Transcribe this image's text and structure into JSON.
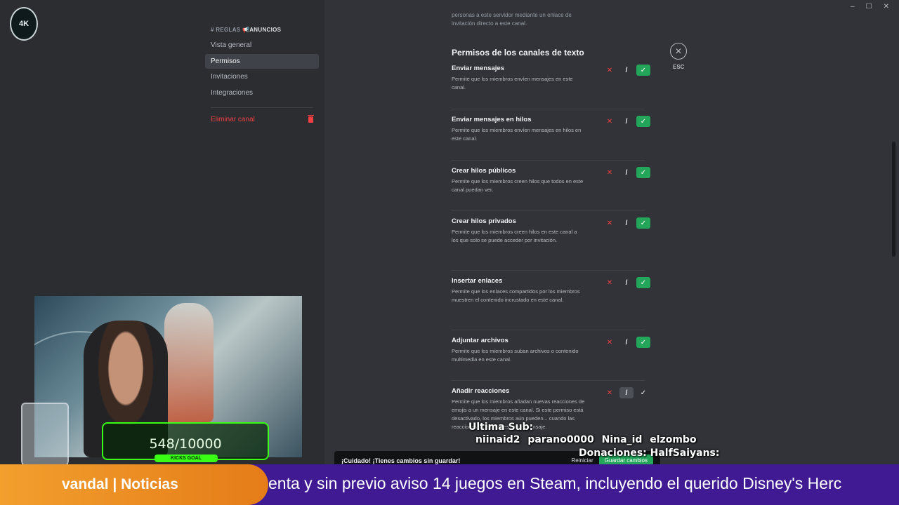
{
  "server": {
    "logo_text": "4K"
  },
  "sidebar": {
    "channel_hash": "#",
    "channel_name": "REGLAS",
    "channel_emoji": "📢",
    "channel_sub": "ANUNCIOS",
    "items": [
      {
        "label": "Vista general",
        "active": false
      },
      {
        "label": "Permisos",
        "active": true
      },
      {
        "label": "Invitaciones",
        "active": false
      },
      {
        "label": "Integraciones",
        "active": false
      }
    ],
    "delete_label": "Eliminar canal"
  },
  "intro_text": "personas a este servidor mediante un enlace de invitación directo a este canal.",
  "section_title": "Permisos de los canales de texto",
  "esc": {
    "icon": "close-icon",
    "label": "ESC"
  },
  "permissions": [
    {
      "name": "Enviar mensajes",
      "desc": "Permite que los miembros envíen mensajes en este canal.",
      "state": "allow"
    },
    {
      "name": "Enviar mensajes en hilos",
      "desc": "Permite que los miembros envíen mensajes en hilos en este canal.",
      "state": "allow"
    },
    {
      "name": "Crear hilos públicos",
      "desc": "Permite que los miembros creen hilos que todos en este canal puedan ver.",
      "state": "allow"
    },
    {
      "name": "Crear hilos privados",
      "desc": "Permite que los miembros creen hilos en este canal a los que solo se puede acceder por invitación.",
      "state": "allow"
    },
    {
      "name": "Insertar enlaces",
      "desc": "Permite que los enlaces compartidos por los miembros muestren el contenido incrustado en este canal.",
      "state": "allow"
    },
    {
      "name": "Adjuntar archivos",
      "desc": "Permite que los miembros suban archivos o contenido multimedia en este canal.",
      "state": "allow"
    },
    {
      "name": "Añadir reacciones",
      "desc": "Permite que los miembros añadan nuevas reacciones de emojis a un mensaje en este canal. Si este permiso está desactivado, los miembros aún pueden... cuando las reacciones ya existentes en un mensaje.",
      "state": "neutral"
    }
  ],
  "toggle_glyphs": {
    "deny": "✕",
    "neutral": "/",
    "allow": "✓"
  },
  "save_bar": {
    "message": "¡Cuidado! ¡Tienes cambios sin guardar!",
    "reset_label": "Reiniciar",
    "save_label": "Guardar cambios"
  },
  "stream": {
    "kicks_value": "548/10000",
    "kicks_label": "KICKS GOAL",
    "last_sub_title": "Ultima Sub:",
    "last_subs": "niinaid2    parano0000    Nina_id    elzombo",
    "donations": "Donaciones: HalfSaiyans:"
  },
  "ticker": {
    "brand": "vandal | Noticias",
    "text": "enta y sin previo aviso 14 juegos en Steam, incluyendo el querido Disney's Herc"
  }
}
